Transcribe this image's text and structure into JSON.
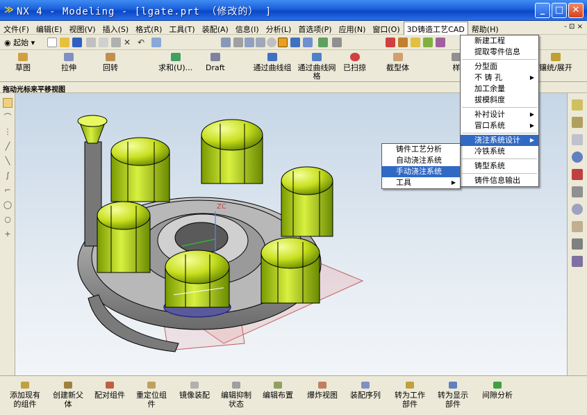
{
  "window": {
    "title": "NX 4 - Modeling - [lgate.prt （修改的） ]"
  },
  "menu": {
    "items": [
      "文件(F)",
      "编辑(E)",
      "视图(V)",
      "插入(S)",
      "格式(R)",
      "工具(T)",
      "装配(A)",
      "信息(I)",
      "分析(L)",
      "首选项(P)",
      "应用(N)",
      "窗口(O)",
      "3D铸造工艺CAD",
      "帮助(H)"
    ],
    "window_controls": "- ⊡ ×"
  },
  "toolbar1": {
    "start_label": "起始"
  },
  "toolbar2": {
    "tools": [
      "草图",
      "拉伸",
      "回转",
      "求和(U)...",
      "Draft",
      "通过曲线组",
      "通过曲线网格",
      "已扫掠",
      "截型体",
      "样",
      "镶统/展开"
    ]
  },
  "cue_line": "拖动光标来平移视图",
  "viewport": {
    "axis_label": "ZC"
  },
  "cad_menu": {
    "items": [
      {
        "label": "新建工程",
        "submenu": false
      },
      {
        "label": "提取零件信息",
        "submenu": false
      },
      {
        "label": "分型面",
        "submenu": false
      },
      {
        "label": "不 铸 孔",
        "submenu": true
      },
      {
        "label": "加工余量",
        "submenu": false
      },
      {
        "label": "拔模斜度",
        "submenu": false
      },
      {
        "label": "补衬设计",
        "submenu": true
      },
      {
        "label": "冒口系统",
        "submenu": true
      },
      {
        "label": "浇注系统设计",
        "submenu": true
      },
      {
        "label": "冷铁系统",
        "submenu": false
      },
      {
        "label": "铸型系统",
        "submenu": false
      },
      {
        "label": "铸件信息输出",
        "submenu": false
      }
    ]
  },
  "pour_submenu": {
    "items": [
      {
        "label": "铸件工艺分析",
        "submenu": false
      },
      {
        "label": "自动浇注系统",
        "submenu": false
      },
      {
        "label": "手动浇注系统",
        "submenu": false
      },
      {
        "label": "工具",
        "submenu": true
      }
    ]
  },
  "assembly_toolbar": {
    "tools": [
      {
        "line1": "添加现有",
        "line2": "的组件"
      },
      {
        "line1": "创建新父",
        "line2": "体"
      },
      {
        "line1": "配对组件",
        "line2": ""
      },
      {
        "line1": "重定位组",
        "line2": "件"
      },
      {
        "line1": "镜像装配",
        "line2": ""
      },
      {
        "line1": "编辑抑制",
        "line2": "状态"
      },
      {
        "line1": "编辑布置",
        "line2": ""
      },
      {
        "line1": "爆炸视图",
        "line2": ""
      },
      {
        "line1": "装配序列",
        "line2": ""
      },
      {
        "line1": "转为工作",
        "line2": "部件"
      },
      {
        "line1": "转为显示",
        "line2": "部件"
      },
      {
        "line1": "间隙分析",
        "line2": ""
      }
    ]
  },
  "colors": {
    "title_blue": "#0a48c8",
    "menu_highlight": "#316ac5",
    "riser_green": "#c8e020",
    "cast_gray": "#8c8c8c"
  }
}
